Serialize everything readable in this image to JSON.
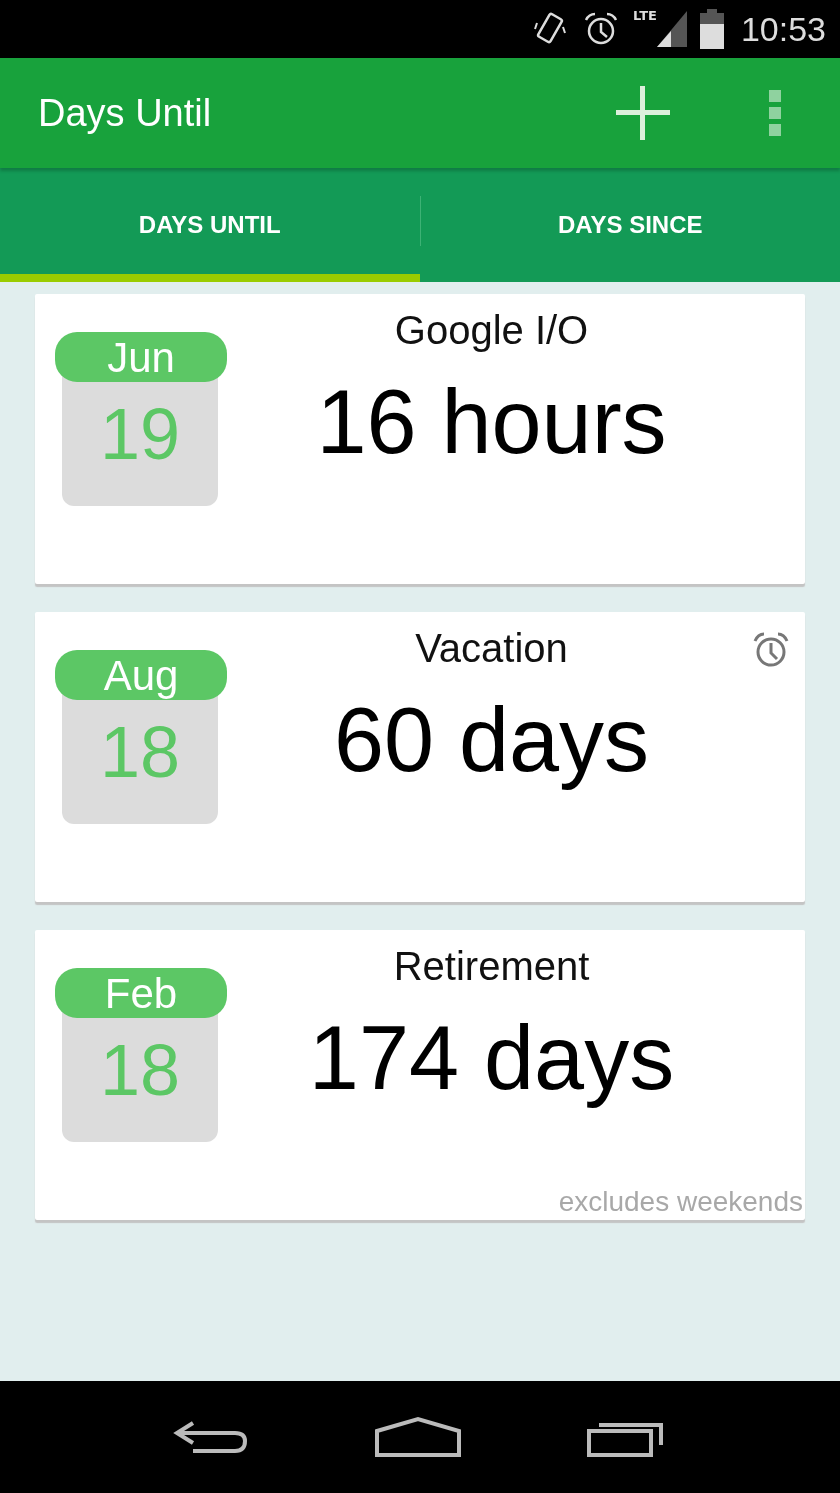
{
  "status_bar": {
    "network": "LTE",
    "time": "10:53"
  },
  "app_bar": {
    "title": "Days Until"
  },
  "tabs": [
    {
      "label": "DAYS UNTIL",
      "selected": true
    },
    {
      "label": "DAYS SINCE",
      "selected": false
    }
  ],
  "events": [
    {
      "title": "Google I/O",
      "month": "Jun",
      "day": "19",
      "countdown": "16 hours",
      "alarm": false
    },
    {
      "title": "Vacation",
      "month": "Aug",
      "day": "18",
      "countdown": "60 days",
      "alarm": true
    },
    {
      "title": "Retirement",
      "month": "Feb",
      "day": "18",
      "countdown": "174 days",
      "alarm": false,
      "note": "excludes weekends"
    }
  ]
}
